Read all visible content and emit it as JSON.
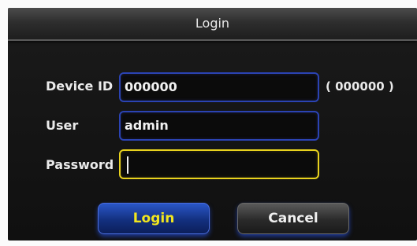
{
  "dialog": {
    "title": "Login"
  },
  "form": {
    "device_id": {
      "label": "Device ID",
      "value": "000000",
      "hint": "( 000000 )"
    },
    "user": {
      "label": "User",
      "value": "admin"
    },
    "password": {
      "label": "Password",
      "value": ""
    }
  },
  "buttons": {
    "login": "Login",
    "cancel": "Cancel"
  },
  "colors": {
    "field_border": "#2b43b3",
    "active_field_border": "#e8d21e",
    "login_text": "#f1e61e"
  }
}
